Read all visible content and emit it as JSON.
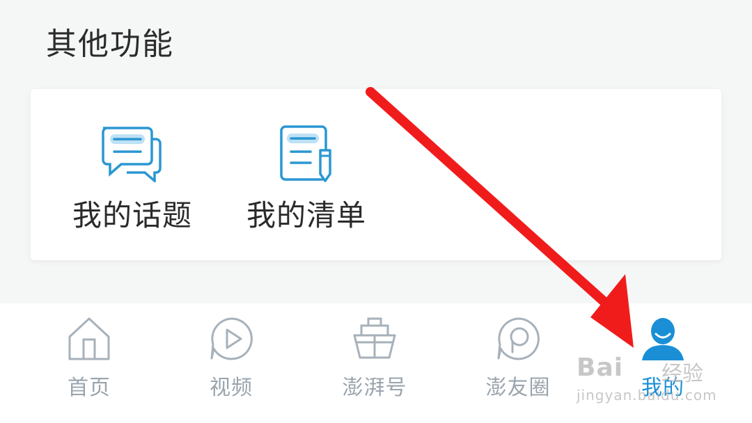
{
  "section": {
    "title": "其他功能"
  },
  "features": [
    {
      "label": "我的话题",
      "icon": "chat-bubbles-icon"
    },
    {
      "label": "我的清单",
      "icon": "document-pencil-icon"
    }
  ],
  "tabbar": {
    "tabs": [
      {
        "label": "首页",
        "icon": "home-icon",
        "active": false
      },
      {
        "label": "视频",
        "icon": "play-circle-icon",
        "active": false
      },
      {
        "label": "澎湃号",
        "icon": "ship-icon",
        "active": false
      },
      {
        "label": "澎友圈",
        "icon": "circle-chat-icon",
        "active": false
      },
      {
        "label": "我的",
        "icon": "user-icon",
        "active": true
      }
    ]
  },
  "watermark": {
    "brand": "Bai",
    "brand2": "经验",
    "url": "jingyan.baidu.com"
  },
  "colors": {
    "accent": "#1a8fd6",
    "icon_blue": "#2a97d2",
    "inactive": "#9aa4ad",
    "arrow": "#f01c1c"
  }
}
